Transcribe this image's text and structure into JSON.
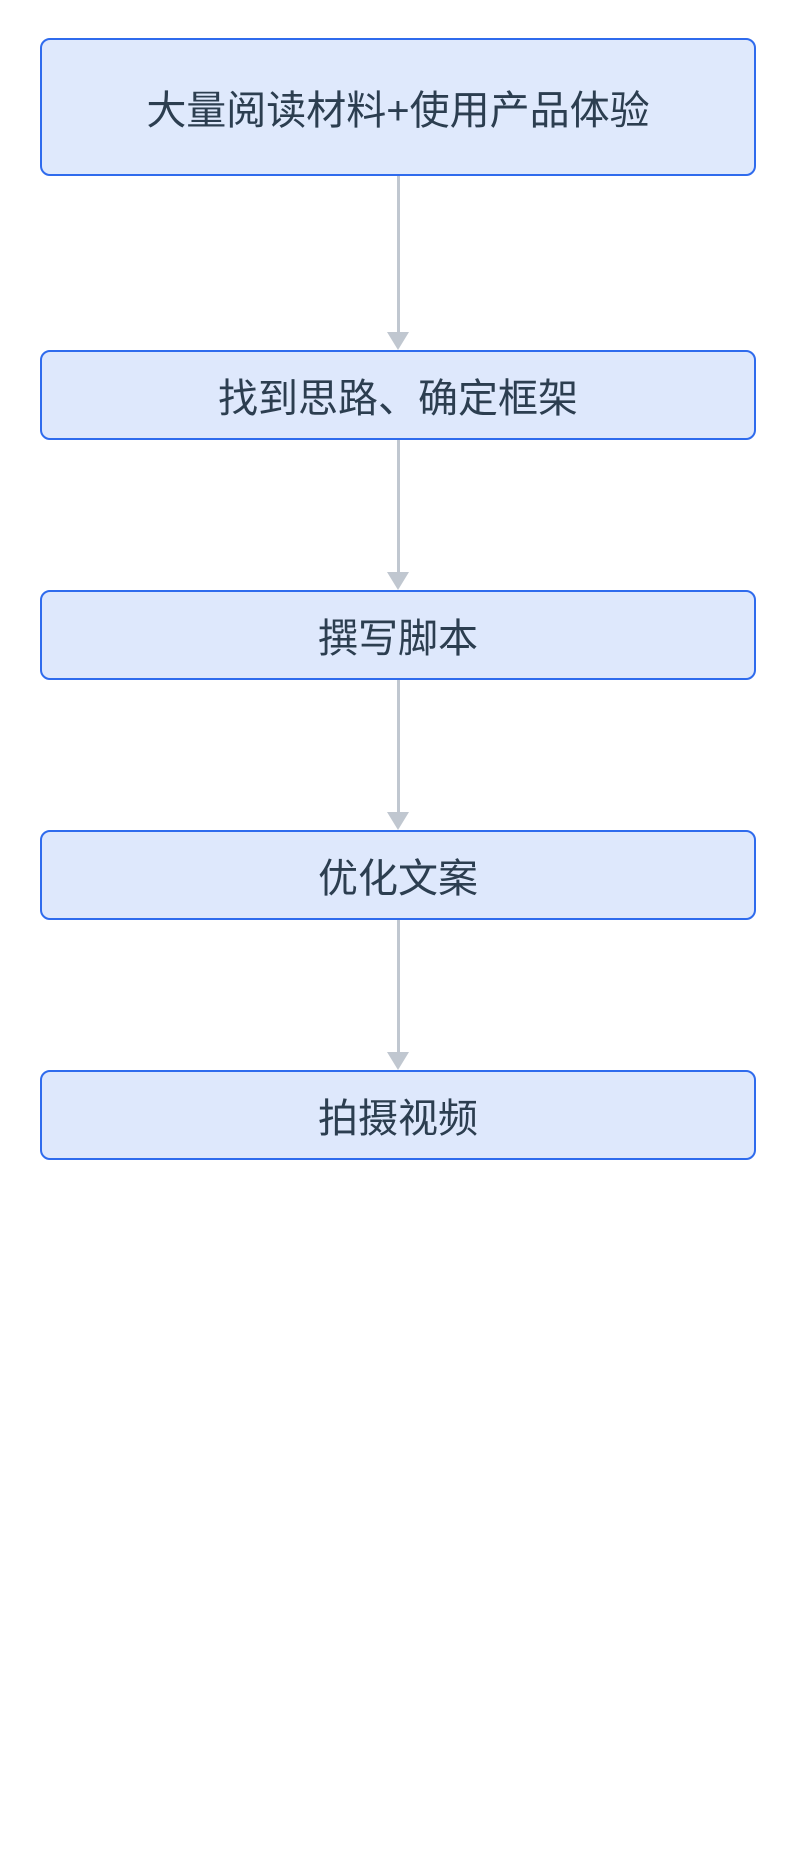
{
  "chart_data": {
    "type": "flowchart",
    "direction": "vertical",
    "nodes": [
      {
        "id": "n1",
        "label": "大量阅读材料+使用产品体验",
        "fill": "#dfe9fc",
        "border": "#2f6bed"
      },
      {
        "id": "n2",
        "label": "找到思路、确定框架",
        "fill": "#dee8fc",
        "border": "#2f6bed"
      },
      {
        "id": "n3",
        "label": "撰写脚本",
        "fill": "#dee8fc",
        "border": "#2f6bed"
      },
      {
        "id": "n4",
        "label": "优化文案",
        "fill": "#dee8fc",
        "border": "#2f6bed"
      },
      {
        "id": "n5",
        "label": "拍摄视频",
        "fill": "#dee8fc",
        "border": "#2f6bed"
      }
    ],
    "edges": [
      {
        "from": "n1",
        "to": "n2"
      },
      {
        "from": "n2",
        "to": "n3"
      },
      {
        "from": "n3",
        "to": "n4"
      },
      {
        "from": "n4",
        "to": "n5"
      }
    ],
    "connector_heights": [
      174,
      150,
      150,
      150
    ]
  }
}
